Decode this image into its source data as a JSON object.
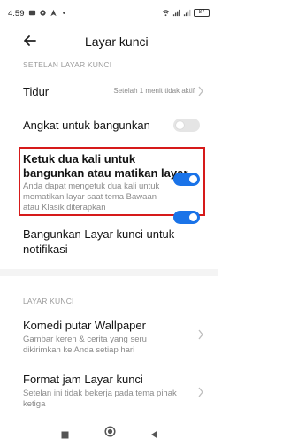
{
  "status_bar": {
    "time": "4:59",
    "battery": "87"
  },
  "header": {
    "title": "Layar kunci"
  },
  "sections": {
    "lock_screen_settings": "SETELAN LAYAR KUNCI",
    "lock_screen": "LAYAR KUNCI"
  },
  "settings": {
    "sleep": {
      "title": "Tidur",
      "value": "Setelah 1 menit tidak aktif"
    },
    "lift_to_wake": {
      "title": "Angkat untuk bangunkan",
      "enabled": false
    },
    "double_tap": {
      "title_line1": "Ketuk dua kali untuk",
      "title_line2": "bangunkan atau matikan layar",
      "sub_line1": "Anda dapat mengetuk dua kali untuk",
      "sub_line2": "mematikan layar saat tema Bawaan",
      "sub_line3": "atau Klasik diterapkan",
      "enabled": true
    },
    "wake_for_notifications": {
      "title_line1": "Bangunkan Layar kunci untuk",
      "title_line2": "notifikasi",
      "enabled": true
    },
    "wallpaper_carousel": {
      "title": "Komedi putar Wallpaper",
      "sub_line1": "Gambar keren & cerita yang seru",
      "sub_line2": "dikirimkan ke Anda setiap hari"
    },
    "clock_format": {
      "title": "Format jam Layar kunci",
      "sub_line1": "Setelan ini tidak bekerja pada tema pihak",
      "sub_line2": "ketiga"
    }
  },
  "colors": {
    "accent": "#1a73e8",
    "highlight": "#d61a1a",
    "toggle_off": "#e5e5e5"
  },
  "icons": {
    "back": "arrow-left-icon",
    "chevron": "chevron-right-icon",
    "nav_recents": "square-icon",
    "nav_home": "circle-icon",
    "nav_back": "triangle-icon"
  }
}
